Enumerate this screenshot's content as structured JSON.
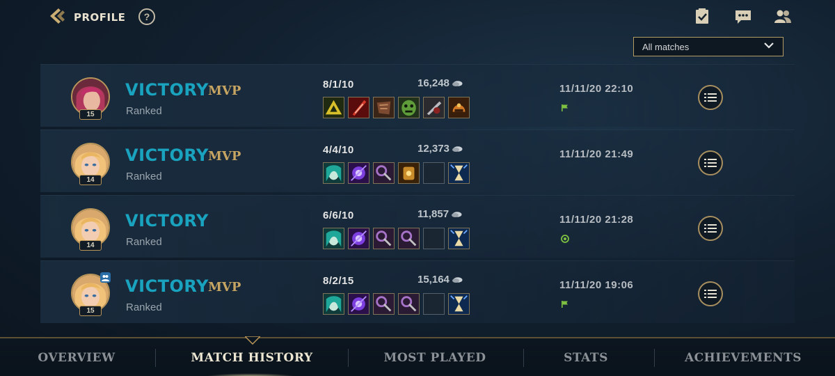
{
  "header": {
    "title": "PROFILE",
    "help_symbol": "?",
    "icons": [
      "missions-icon",
      "chat-icon",
      "friends-icon"
    ]
  },
  "filter": {
    "selected": "All matches"
  },
  "matches": [
    {
      "result": "VICTORY",
      "mvp": "MVP",
      "queue": "Ranked",
      "level": "15",
      "kda": "8/1/10",
      "gold": "16,248",
      "datetime": "11/11/20 22:10",
      "status_icon": "flag-icon",
      "party": false,
      "items": [
        "item-triforce",
        "item-red-blade",
        "item-armor-plate",
        "item-green-mask",
        "item-dark-blade",
        "item-orange-helm"
      ]
    },
    {
      "result": "VICTORY",
      "mvp": "MVP",
      "queue": "Ranked",
      "level": "14",
      "kda": "4/4/10",
      "gold": "12,373",
      "datetime": "11/11/20 21:49",
      "status_icon": "none",
      "party": false,
      "items": [
        "item-teal-face",
        "item-purple-orb",
        "item-purple-chain",
        "item-gold-relic",
        "empty",
        "item-hourglass"
      ]
    },
    {
      "result": "VICTORY",
      "mvp": "",
      "queue": "Ranked",
      "level": "14",
      "kda": "6/6/10",
      "gold": "11,857",
      "datetime": "11/11/20 21:28",
      "status_icon": "target-icon",
      "party": false,
      "items": [
        "item-teal-face",
        "item-purple-orb",
        "item-purple-chain",
        "item-purple-chain",
        "empty",
        "item-hourglass"
      ]
    },
    {
      "result": "VICTORY",
      "mvp": "MVP",
      "queue": "Ranked",
      "level": "15",
      "kda": "8/2/15",
      "gold": "15,164",
      "datetime": "11/11/20 19:06",
      "status_icon": "flag-icon",
      "party": true,
      "items": [
        "item-teal-face",
        "item-purple-orb",
        "item-purple-chain",
        "item-purple-chain",
        "empty",
        "item-hourglass"
      ]
    }
  ],
  "tabs": [
    {
      "label": "OVERVIEW",
      "active": false
    },
    {
      "label": "MATCH HISTORY",
      "active": true
    },
    {
      "label": "MOST PLAYED",
      "active": false
    },
    {
      "label": "STATS",
      "active": false
    },
    {
      "label": "ACHIEVEMENTS",
      "active": false
    }
  ],
  "colors": {
    "victory": "#1aa3bf",
    "mvp": "#c6a462",
    "gold_border": "#b59c64",
    "status_green": "#7fc242"
  }
}
